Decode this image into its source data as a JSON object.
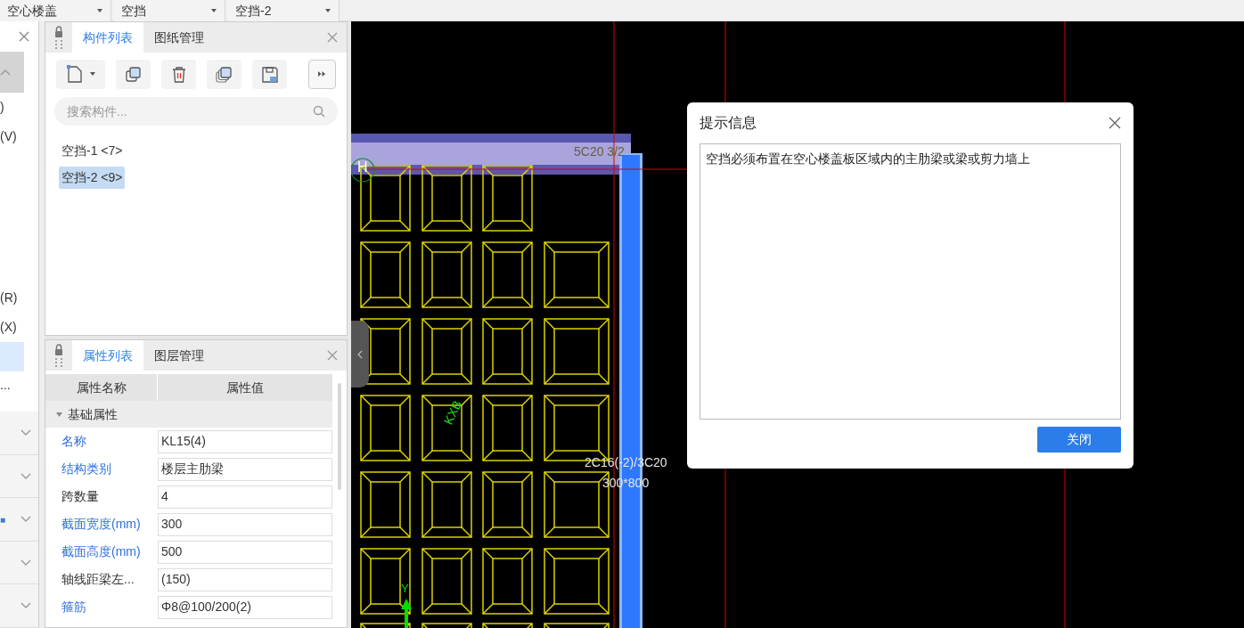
{
  "top_bar": {
    "dropdowns": [
      {
        "value": "空心楼盖"
      },
      {
        "value": "空挡"
      },
      {
        "value": "空挡-2"
      }
    ]
  },
  "left_panel": {
    "sections": [
      {
        "items": [
          {
            "kind": "group",
            "selected": true
          },
          {
            "text": ")",
            "kind": "item",
            "selected": false
          },
          {
            "text": "(V)",
            "kind": "item",
            "selected": false
          }
        ]
      },
      {
        "items": [
          {
            "text": "(R)",
            "kind": "item",
            "selected": false
          },
          {
            "text": "(X)",
            "kind": "item",
            "selected": false
          },
          {
            "kind": "item",
            "selected": true
          },
          {
            "text": "...",
            "kind": "item",
            "selected": false
          }
        ]
      }
    ],
    "accordions": [
      {
        "expanded": false
      },
      {
        "expanded": false
      },
      {
        "text": "■",
        "expanded": false
      },
      {
        "expanded": false
      },
      {
        "expanded": false
      }
    ]
  },
  "component_panel": {
    "tabs": [
      {
        "label": "构件列表",
        "selected": true
      },
      {
        "label": "图纸管理",
        "selected": false
      }
    ],
    "search": {
      "placeholder": "搜索构件..."
    },
    "items": [
      {
        "label": "空挡-1 <7>",
        "selected": false
      },
      {
        "label": "空挡-2 <9>",
        "selected": true
      }
    ]
  },
  "property_panel": {
    "tabs": [
      {
        "label": "属性列表",
        "selected": true
      },
      {
        "label": "图层管理",
        "selected": false
      }
    ],
    "columns": [
      "属性名称",
      "属性值"
    ],
    "group": {
      "label": "基础属性",
      "expanded": true
    },
    "rows": [
      {
        "name": "名称",
        "value": "KL15(4)",
        "common": true
      },
      {
        "name": "结构类别",
        "value": "楼层主肋梁",
        "common": true
      },
      {
        "name": "跨数量",
        "value": "4",
        "common": false
      },
      {
        "name": "截面宽度(mm)",
        "value": "300",
        "common": true
      },
      {
        "name": "截面高度(mm)",
        "value": "500",
        "common": true
      },
      {
        "name": "轴线距梁左...",
        "value": "(150)",
        "common": false
      },
      {
        "name": "箍筋",
        "value": "Φ8@100/200(2)",
        "common": true
      }
    ]
  },
  "canvas": {
    "labels": [
      {
        "text": "5C20 3/2",
        "kind": "beam"
      },
      {
        "text": "H",
        "kind": "marker"
      },
      {
        "text": "KXB",
        "kind": "slab"
      },
      {
        "text": "2C16(-2)/3C20",
        "kind": "rebar"
      },
      {
        "text": "300*800",
        "kind": "section"
      },
      {
        "text": "Y",
        "kind": "axis"
      }
    ]
  },
  "dialog": {
    "title": "提示信息",
    "message": "空挡必须布置在空心楼盖板区域内的主肋梁或梁或剪力墙上",
    "button": "关闭"
  }
}
